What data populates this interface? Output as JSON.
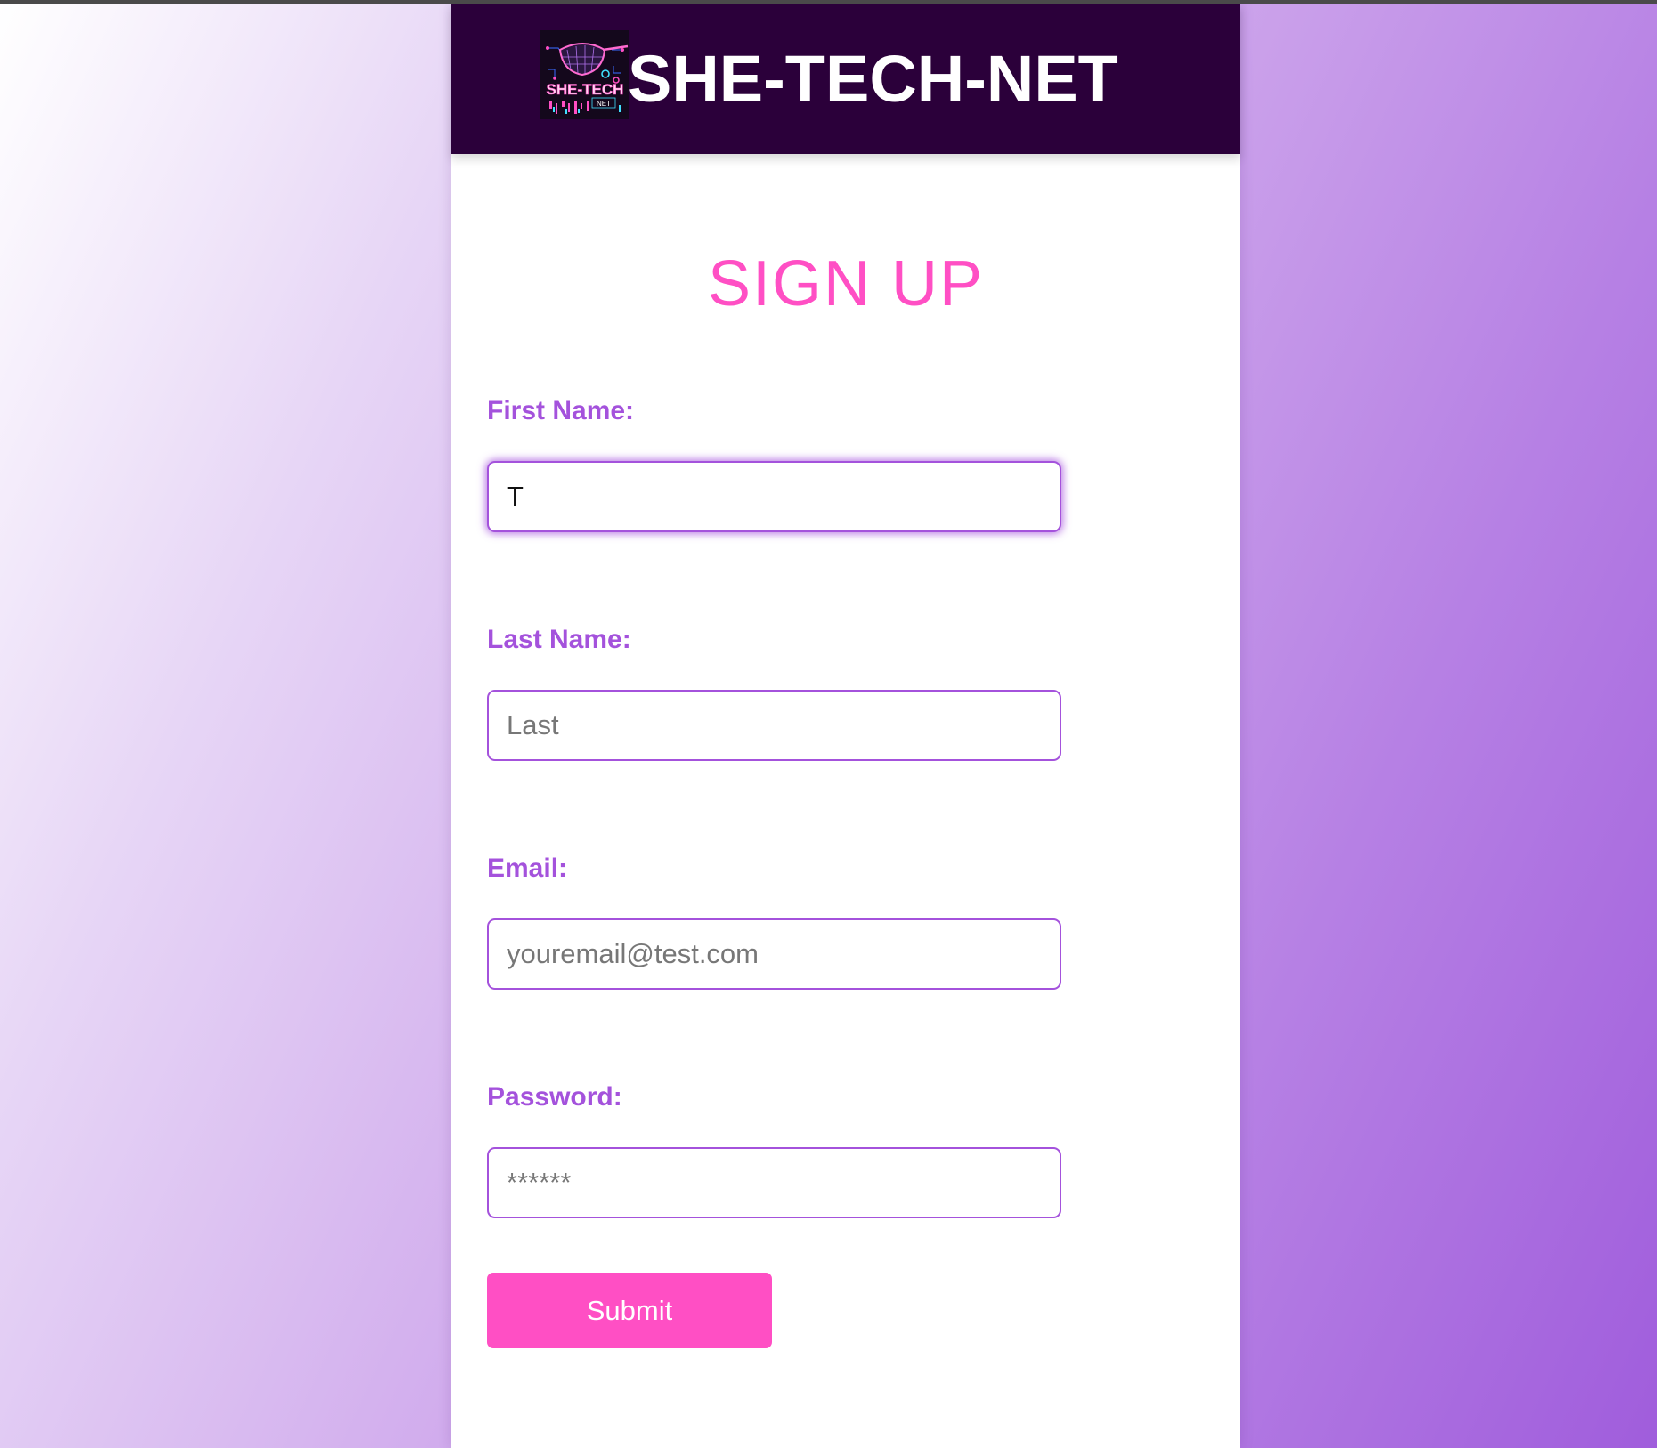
{
  "header": {
    "brand": "SHE-TECH-NET",
    "logo_text": "SHE-TECH",
    "logo_subtext": "NET"
  },
  "form": {
    "title": "SIGN UP",
    "fields": [
      {
        "label": "First Name:",
        "value": "T",
        "placeholder": ""
      },
      {
        "label": "Last Name:",
        "value": "",
        "placeholder": "Last"
      },
      {
        "label": "Email:",
        "value": "",
        "placeholder": "youremail@test.com"
      },
      {
        "label": "Password:",
        "value": "",
        "placeholder": "******"
      }
    ],
    "submit_label": "Submit"
  },
  "colors": {
    "header_bg": "#2b003a",
    "title": "#ff4fc4",
    "label": "#a452dc",
    "button": "#ff4fc4"
  },
  "icons": {
    "logo": "she-tech-net-logo"
  }
}
